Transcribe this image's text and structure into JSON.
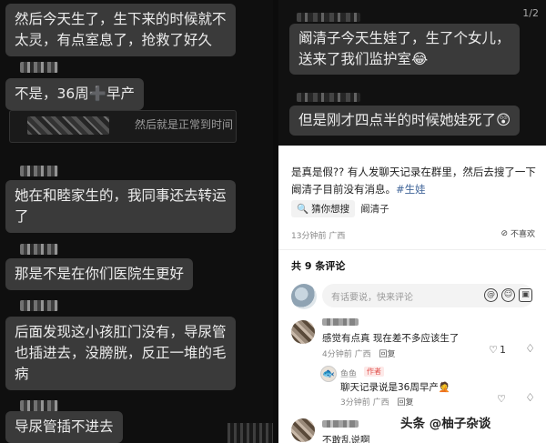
{
  "left_chat": {
    "messages": [
      {
        "line1": "然后今天生了，生下来的时候就不",
        "line2": "太灵，有点室息了，抢救了好久"
      },
      {
        "text_a": "不是，36周",
        "emoji": "➕",
        "text_b": "早产"
      },
      {
        "quote": "然后就是正常到时间"
      },
      {
        "line1": "她在和睦家生的，我同事还去转运",
        "line2": "了"
      },
      {
        "text": "那是不是在你们医院生更好"
      },
      {
        "line1": "后面发现这小孩肛门没有，导尿管",
        "line2": "也插进去，没膀胱，反正一堆的毛",
        "line3": "病"
      },
      {
        "text": "导尿管插不进去"
      }
    ]
  },
  "right_chat": {
    "page_counter": "1/2",
    "messages": [
      {
        "line1": "阚清子今天生娃了，生了个女儿，",
        "line2": "送来了我们监护室",
        "emoji": "😂"
      },
      {
        "text": "但是刚才四点半的时候她娃死了",
        "emoji": "😲"
      }
    ]
  },
  "post": {
    "text": "是真是假?? 有人发聊天记录在群里，然后去搜了一下阚清子目前没有消息。",
    "tag": "#生娃",
    "guess_label": "猜你想搜",
    "guess_word": "阚清子",
    "time_loc": "13分钟前 广西",
    "no_like": "不喜欢",
    "comment_count": "共 9 条评论",
    "comment_placeholder": "有话要说，快来评论",
    "input_icons": [
      "at-icon",
      "emoji-icon",
      "image-icon"
    ],
    "comments": [
      {
        "text": "感觉有点真 现在差不多应该生了",
        "meta": "4分钟前 广西",
        "reply": "回复",
        "likes": "1"
      },
      {
        "author": "鱼鱼",
        "badge": "作者",
        "text": "聊天记录说是36周早产",
        "emoji": "🤦",
        "meta": "3分钟前 广西",
        "reply": "回复"
      },
      {
        "text": "不敢乱说啊"
      }
    ]
  },
  "watermark": {
    "logo": "头",
    "text": "头条 @柚子杂谈"
  }
}
